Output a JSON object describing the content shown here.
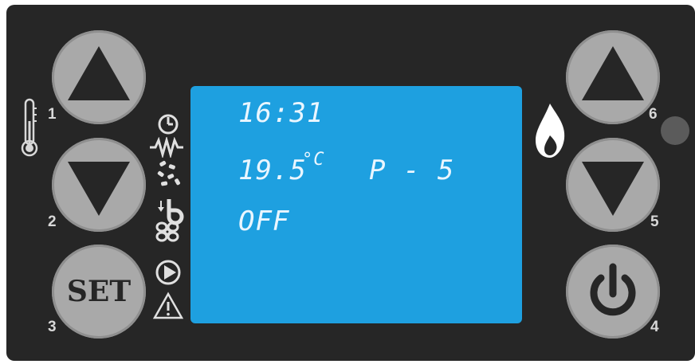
{
  "display": {
    "time": "16:31",
    "temperature": "19.5",
    "unit": "°C",
    "power_level": "P - 5",
    "state": "OFF"
  },
  "buttons": {
    "b1_number": "1",
    "b2_number": "2",
    "b3_number": "3",
    "b4_number": "4",
    "b5_number": "5",
    "b6_number": "6",
    "set_label": "SET"
  },
  "colors": {
    "panel": "#262626",
    "button": "#a9a9a9",
    "lcd": "#1ea0e0",
    "lcd_text": "#eaf6ff",
    "led": "#5b5b5b"
  },
  "icons": [
    "thermometer-icon",
    "clock-icon",
    "resistor-icon",
    "pellet-icon",
    "fan-icon",
    "pump-icon",
    "warning-icon",
    "flame-icon",
    "power-icon"
  ]
}
